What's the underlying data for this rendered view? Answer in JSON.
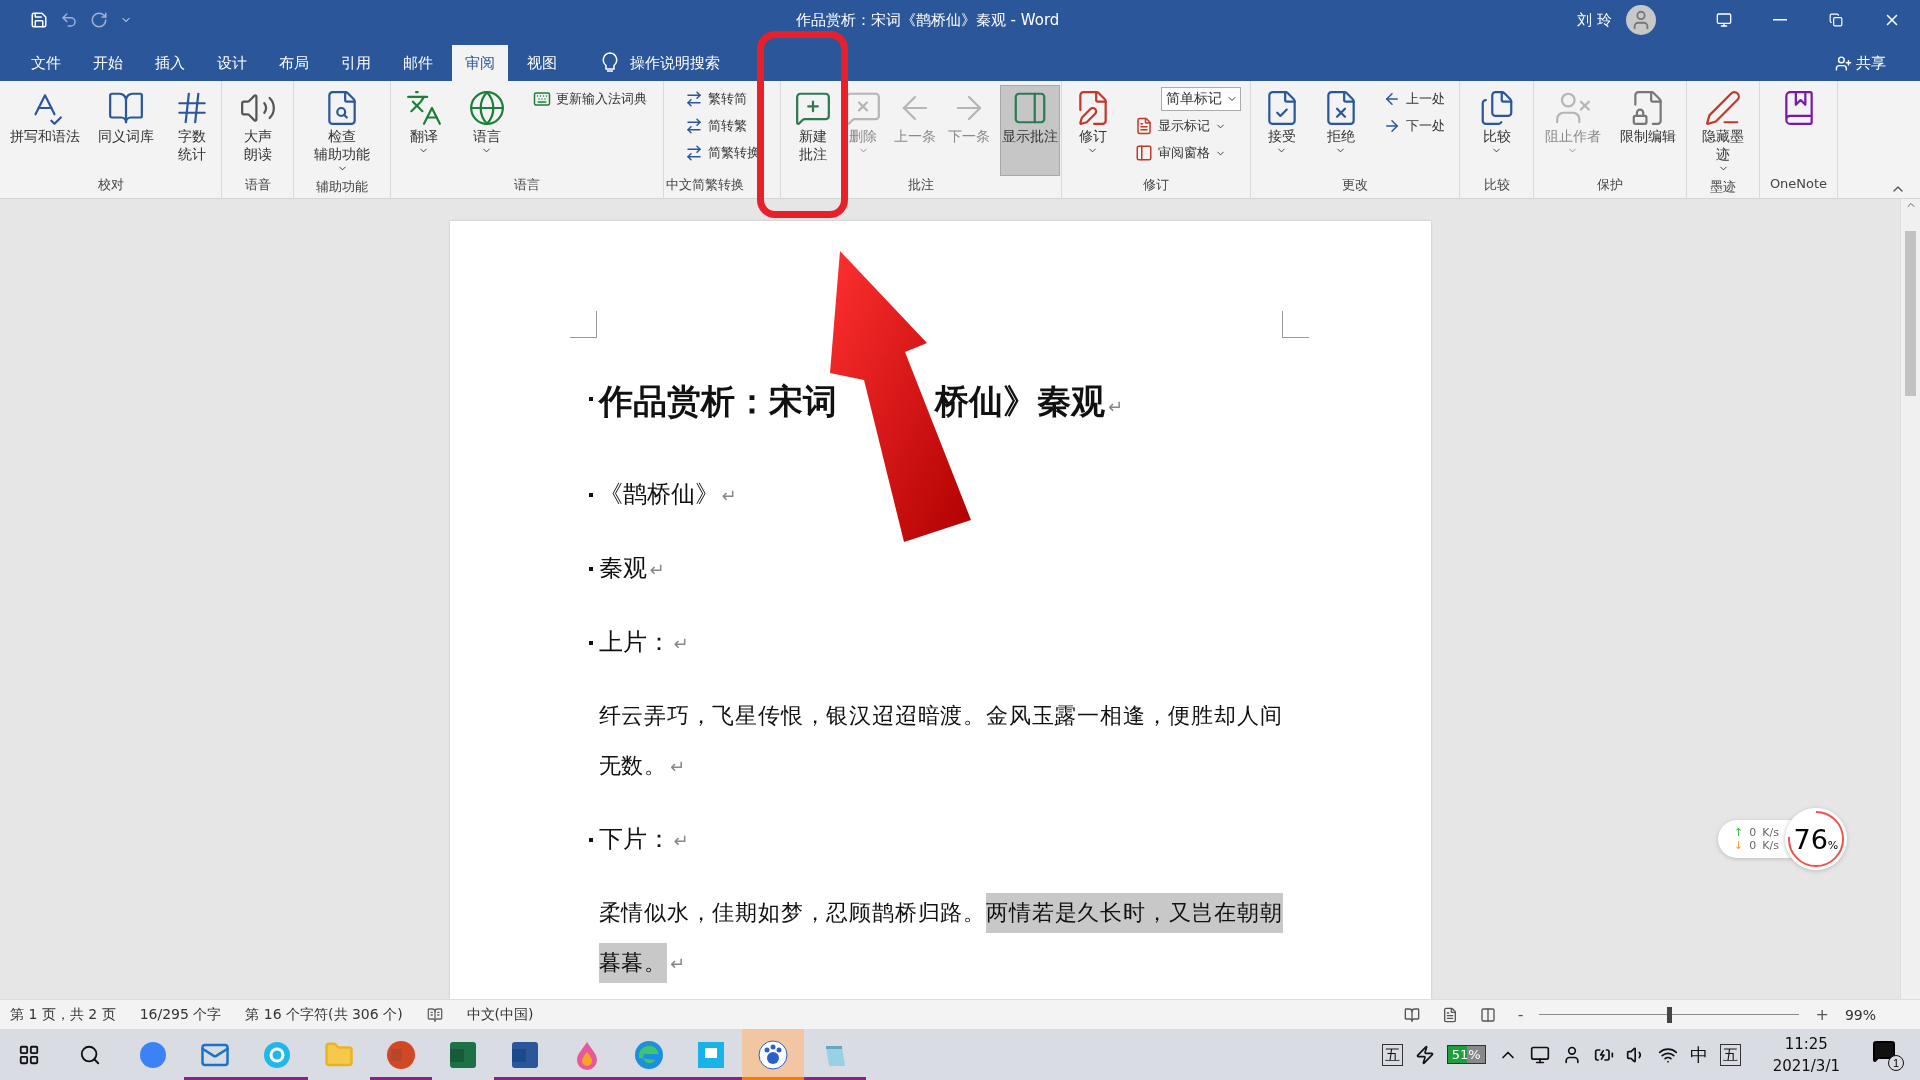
{
  "title_bar": {
    "title": "作品赏析：宋词《鹊桥仙》秦观  -  Word",
    "user": "刘 玲"
  },
  "tabs": [
    {
      "label": "文件",
      "selected": false
    },
    {
      "label": "开始",
      "selected": false
    },
    {
      "label": "插入",
      "selected": false
    },
    {
      "label": "设计",
      "selected": false
    },
    {
      "label": "布局",
      "selected": false
    },
    {
      "label": "引用",
      "selected": false
    },
    {
      "label": "邮件",
      "selected": false
    },
    {
      "label": "审阅",
      "selected": true
    },
    {
      "label": "视图",
      "selected": false
    }
  ],
  "tell_me": "操作说明搜索",
  "share": "共享",
  "ribbon": [
    {
      "label": "校对",
      "items": [
        {
          "kind": "large",
          "lines": [
            "拼写和语法"
          ],
          "menu": false,
          "disabled": false
        },
        {
          "kind": "large",
          "lines": [
            "同义词库"
          ],
          "menu": false,
          "disabled": false
        },
        {
          "kind": "large",
          "lines": [
            "字数",
            "统计"
          ],
          "menu": false,
          "disabled": false
        }
      ]
    },
    {
      "label": "语音",
      "items": [
        {
          "kind": "large",
          "lines": [
            "大声",
            "朗读"
          ],
          "menu": false,
          "disabled": false
        }
      ]
    },
    {
      "label": "辅助功能",
      "items": [
        {
          "kind": "large",
          "lines": [
            "检查",
            "辅助功能"
          ],
          "menu": true,
          "disabled": false
        }
      ]
    },
    {
      "label": "语言",
      "items": [
        {
          "kind": "large",
          "lines": [
            "翻译"
          ],
          "menu": true,
          "disabled": false
        },
        {
          "kind": "large",
          "lines": [
            "语言"
          ],
          "menu": true,
          "disabled": false
        },
        {
          "kind": "stack",
          "items": [
            {
              "kind": "small",
              "label": "更新输入法词典"
            }
          ]
        }
      ]
    },
    {
      "label": "中文简繁转换",
      "items": [
        {
          "kind": "stack",
          "items": [
            {
              "kind": "small",
              "label": "繁转简"
            },
            {
              "kind": "small",
              "label": "简转繁"
            },
            {
              "kind": "small",
              "label": "简繁转换"
            }
          ]
        }
      ]
    },
    {
      "label": "批注",
      "items": [
        {
          "kind": "large",
          "lines": [
            "新建",
            "批注"
          ],
          "menu": false,
          "disabled": false
        },
        {
          "kind": "large",
          "lines": [
            "删除"
          ],
          "menu": true,
          "disabled": true
        },
        {
          "kind": "large",
          "lines": [
            "上一条"
          ],
          "menu": false,
          "disabled": true
        },
        {
          "kind": "large",
          "lines": [
            "下一条"
          ],
          "menu": false,
          "disabled": true
        },
        {
          "kind": "large",
          "lines": [
            "显示批注"
          ],
          "menu": false,
          "disabled": false,
          "selected": true
        }
      ]
    },
    {
      "label": "修订",
      "items": [
        {
          "kind": "large",
          "lines": [
            "修订"
          ],
          "menu": true,
          "disabled": false
        },
        {
          "kind": "stack",
          "items": [
            {
              "kind": "select",
              "label": "简单标记"
            },
            {
              "kind": "small",
              "label": "显示标记"
            },
            {
              "kind": "small",
              "label": "审阅窗格"
            }
          ]
        }
      ]
    },
    {
      "label": "更改",
      "items": [
        {
          "kind": "large",
          "lines": [
            "接受"
          ],
          "menu": true,
          "disabled": false
        },
        {
          "kind": "large",
          "lines": [
            "拒绝"
          ],
          "menu": true,
          "disabled": false
        },
        {
          "kind": "stack",
          "items": [
            {
              "kind": "small",
              "label": "上一处"
            },
            {
              "kind": "small",
              "label": "下一处"
            }
          ]
        }
      ]
    },
    {
      "label": "比较",
      "items": [
        {
          "kind": "large",
          "lines": [
            "比较"
          ],
          "menu": true,
          "disabled": false
        }
      ]
    },
    {
      "label": "保护",
      "items": [
        {
          "kind": "large",
          "lines": [
            "阻止作者"
          ],
          "menu": true,
          "disabled": true
        },
        {
          "kind": "large",
          "lines": [
            "限制编辑"
          ],
          "menu": false,
          "disabled": false
        }
      ]
    },
    {
      "label": "墨迹",
      "items": [
        {
          "kind": "large",
          "lines": [
            "隐藏墨",
            "迹"
          ],
          "menu": true,
          "disabled": false
        }
      ]
    },
    {
      "label": "OneNote",
      "items": [
        {
          "kind": "large",
          "menu": false,
          "disabled": false
        }
      ]
    }
  ],
  "document": [
    {
      "kind": "heading",
      "bullet": true,
      "segments": [
        {
          "text": "作品赏析：宋词",
          "highlighted": false
        },
        {
          "text": "桥仙》秦观",
          "highlighted": false
        }
      ],
      "mark": "↵"
    },
    {
      "kind": "line",
      "bullet": true,
      "segments": [
        {
          "text": "《鹊桥仙》",
          "highlighted": false
        }
      ],
      "mark": "↵"
    },
    {
      "kind": "line",
      "bullet": true,
      "segments": [
        {
          "text": "秦观",
          "highlighted": false
        }
      ],
      "mark": "↵"
    },
    {
      "kind": "line",
      "bullet": true,
      "segments": [
        {
          "text": "上片：",
          "highlighted": false
        }
      ],
      "mark": "↵"
    },
    {
      "kind": "body",
      "bullet": false,
      "segments": [
        {
          "text": "纤云弄巧，飞星传恨，银汉迢迢暗渡。金风玉露一相逢，便胜却人间无数。",
          "highlighted": false
        }
      ],
      "mark": "↵"
    },
    {
      "kind": "line",
      "bullet": true,
      "segments": [
        {
          "text": "下片：",
          "highlighted": false
        }
      ],
      "mark": "↵"
    },
    {
      "kind": "body",
      "bullet": false,
      "segments": [
        {
          "text": "柔情似水，佳期如梦，忍顾鹊桥归路。",
          "highlighted": false
        },
        {
          "text": "两情若是久长时，又岂在朝朝暮暮。",
          "highlighted": true
        }
      ],
      "mark": "↵"
    }
  ],
  "status_bar": {
    "items": [
      "第 1 页，共 2 页",
      "16/295 个字",
      "第 16 个字符(共 306 个)"
    ],
    "language": "中文(中国)",
    "zoom_out": "-",
    "zoom_in": "+",
    "zoom": {
      "level": 0.5
    },
    "zoom_text": "99%"
  },
  "net_widget": {
    "up_arrow": "↑",
    "up": "0",
    "up_unit": "K/s",
    "down_arrow": "↓",
    "down": "0",
    "down_unit": "K/s",
    "value": "76",
    "percent": "%"
  },
  "taskbar": {
    "apps": [
      {
        "running": false,
        "selected": false
      },
      {
        "running": true,
        "selected": false
      },
      {
        "running": true,
        "selected": false
      },
      {
        "running": false,
        "selected": false
      },
      {
        "running": true,
        "selected": false
      },
      {
        "running": false,
        "selected": false
      },
      {
        "running": true,
        "selected": false
      },
      {
        "running": true,
        "selected": false
      },
      {
        "running": true,
        "selected": false
      },
      {
        "running": true,
        "selected": false
      },
      {
        "running": false,
        "selected": true
      },
      {
        "running": true,
        "selected": false
      }
    ],
    "ime": "五",
    "battery": "51%",
    "input_lang": "中",
    "ime2": "五",
    "time": "11:25",
    "date": "2021/3/1",
    "notifications": "1"
  }
}
